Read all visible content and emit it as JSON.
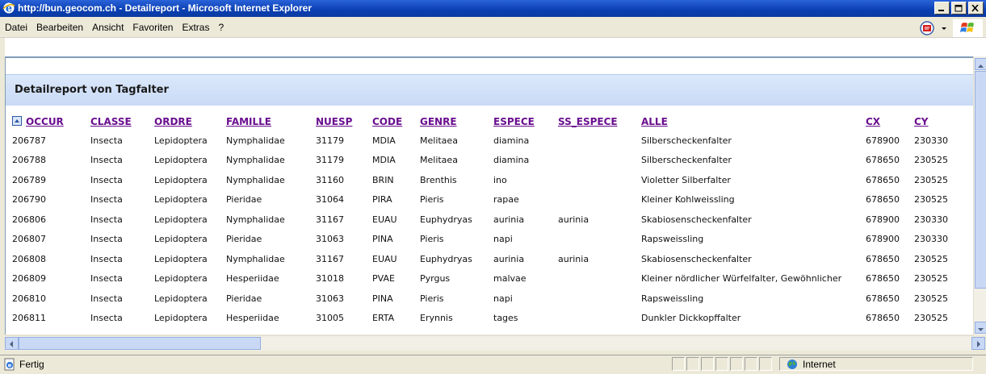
{
  "window": {
    "title": "http://bun.geocom.ch - Detailreport - Microsoft Internet Explorer"
  },
  "menu": [
    "Datei",
    "Bearbeiten",
    "Ansicht",
    "Favoriten",
    "Extras",
    "?"
  ],
  "report": {
    "title": "Detailreport von Tagfalter"
  },
  "table": {
    "columns": [
      "OCCUR",
      "CLASSE",
      "ORDRE",
      "FAMILLE",
      "NUESP",
      "CODE",
      "GENRE",
      "ESPECE",
      "SS_ESPECE",
      "ALLE",
      "CX",
      "CY"
    ],
    "rows": [
      [
        "206787",
        "Insecta",
        "Lepidoptera",
        "Nymphalidae",
        "31179",
        "MDIA",
        "Melitaea",
        "diamina",
        "",
        "Silberscheckenfalter",
        "678900",
        "230330"
      ],
      [
        "206788",
        "Insecta",
        "Lepidoptera",
        "Nymphalidae",
        "31179",
        "MDIA",
        "Melitaea",
        "diamina",
        "",
        "Silberscheckenfalter",
        "678650",
        "230525"
      ],
      [
        "206789",
        "Insecta",
        "Lepidoptera",
        "Nymphalidae",
        "31160",
        "BRIN",
        "Brenthis",
        "ino",
        "",
        "Violetter Silberfalter",
        "678650",
        "230525"
      ],
      [
        "206790",
        "Insecta",
        "Lepidoptera",
        "Pieridae",
        "31064",
        "PIRA",
        "Pieris",
        "rapae",
        "",
        "Kleiner Kohlweissling",
        "678650",
        "230525"
      ],
      [
        "206806",
        "Insecta",
        "Lepidoptera",
        "Nymphalidae",
        "31167",
        "EUAU",
        "Euphydryas",
        "aurinia",
        "aurinia",
        "Skabiosenscheckenfalter",
        "678900",
        "230330"
      ],
      [
        "206807",
        "Insecta",
        "Lepidoptera",
        "Pieridae",
        "31063",
        "PINA",
        "Pieris",
        "napi",
        "",
        "Rapsweissling",
        "678900",
        "230330"
      ],
      [
        "206808",
        "Insecta",
        "Lepidoptera",
        "Nymphalidae",
        "31167",
        "EUAU",
        "Euphydryas",
        "aurinia",
        "aurinia",
        "Skabiosenscheckenfalter",
        "678650",
        "230525"
      ],
      [
        "206809",
        "Insecta",
        "Lepidoptera",
        "Hesperiidae",
        "31018",
        "PVAE",
        "Pyrgus",
        "malvae",
        "",
        "Kleiner nördlicher Würfelfalter, Gewöhnlicher",
        "678650",
        "230525"
      ],
      [
        "206810",
        "Insecta",
        "Lepidoptera",
        "Pieridae",
        "31063",
        "PINA",
        "Pieris",
        "napi",
        "",
        "Rapsweissling",
        "678650",
        "230525"
      ],
      [
        "206811",
        "Insecta",
        "Lepidoptera",
        "Hesperiidae",
        "31005",
        "ERTA",
        "Erynnis",
        "tages",
        "",
        "Dunkler Dickkopffalter",
        "678650",
        "230525"
      ]
    ]
  },
  "status": {
    "text": "Fertig",
    "zone": "Internet"
  },
  "colors": {
    "header_link": "#6a0f8f",
    "report_bar": "#c8daf6",
    "titlebar": "#0a3fb2"
  }
}
